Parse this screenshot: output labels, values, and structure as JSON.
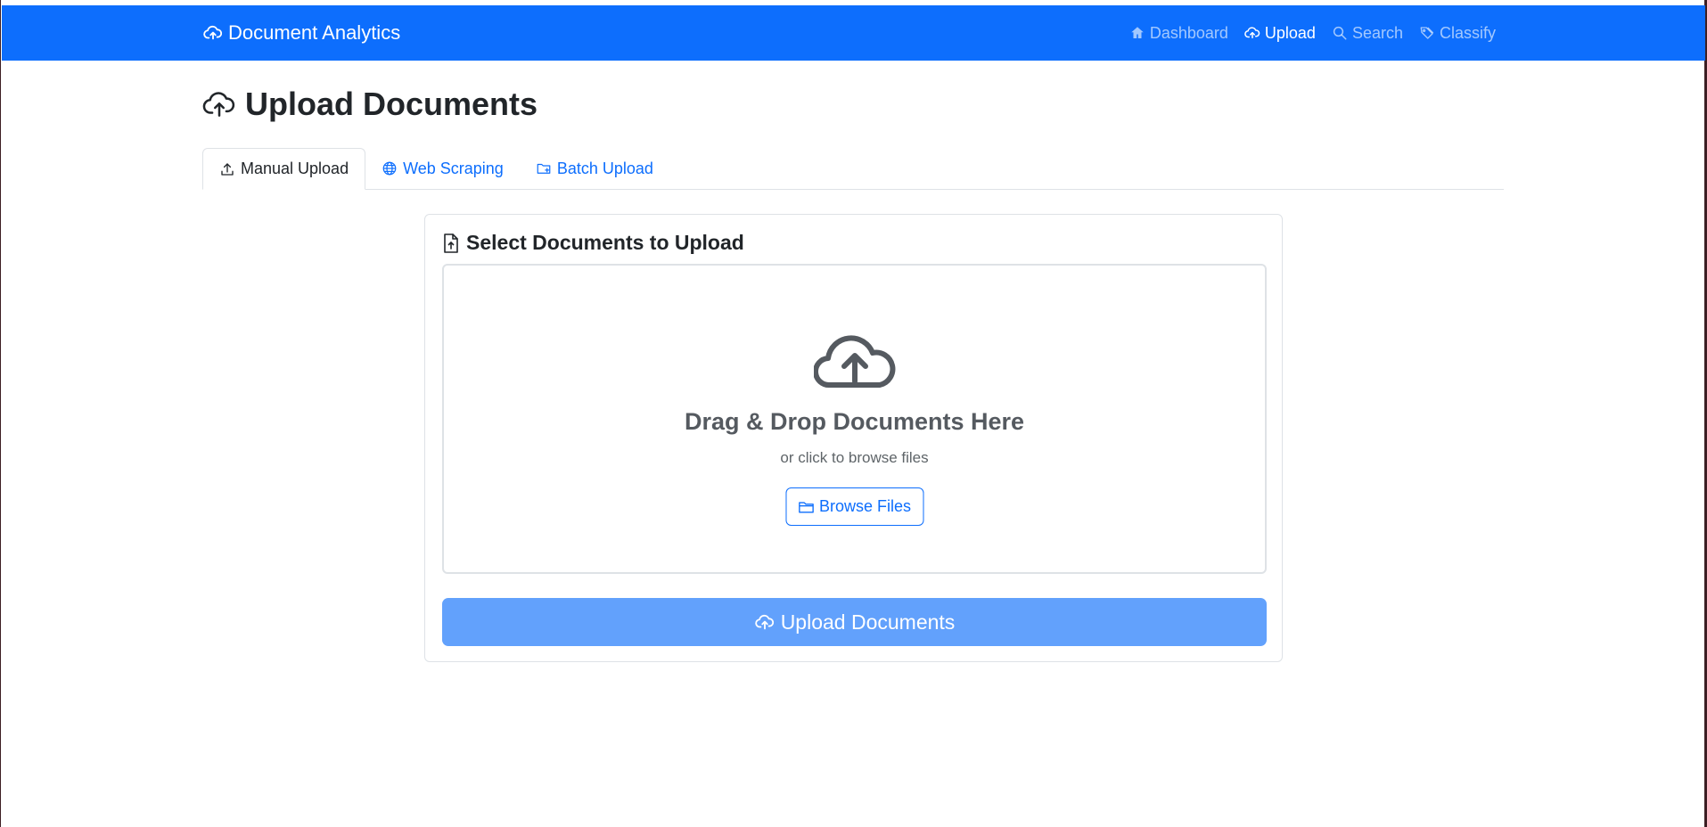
{
  "navbar": {
    "brand": "Document Analytics",
    "brand_icon": "cloud-upload-icon",
    "links": [
      {
        "label": "Dashboard",
        "icon": "house-icon",
        "active": false
      },
      {
        "label": "Upload",
        "icon": "cloud-upload-icon",
        "active": true
      },
      {
        "label": "Search",
        "icon": "search-icon",
        "active": false
      },
      {
        "label": "Classify",
        "icon": "tags-icon",
        "active": false
      }
    ],
    "bg_color": "#0d6efd"
  },
  "page": {
    "title": "Upload Documents",
    "title_icon": "cloud-upload-icon"
  },
  "tabs": [
    {
      "label": "Manual Upload",
      "icon": "upload-icon",
      "active": true
    },
    {
      "label": "Web Scraping",
      "icon": "globe-icon",
      "active": false
    },
    {
      "label": "Batch Upload",
      "icon": "folder-plus-icon",
      "active": false
    }
  ],
  "upload_card": {
    "title": "Select Documents to Upload",
    "title_icon": "file-upload-icon",
    "dropzone": {
      "icon": "cloud-arrow-up-icon",
      "title": "Drag & Drop Documents Here",
      "subtitle": "or click to browse files",
      "browse_label": "Browse Files",
      "browse_icon": "folder-icon"
    },
    "submit_label": "Upload Documents",
    "submit_icon": "cloud-upload-icon",
    "submit_color": "#62a1fc"
  }
}
